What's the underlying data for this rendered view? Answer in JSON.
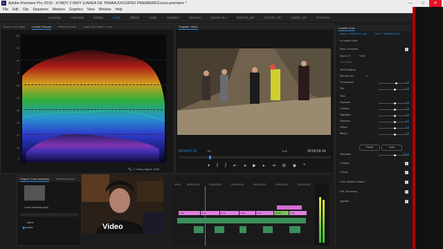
{
  "window": {
    "title": "Adobe Premiere Pro 2019 - X:\\NDY 2 INDY (LAREA DE TRABAJO\\CURSO PREMIERE\\Curso premiere *",
    "controls": [
      "—",
      "□",
      "✕"
    ]
  },
  "menu": [
    "File",
    "Edit",
    "Clip",
    "Sequence",
    "Markers",
    "Graphics",
    "View",
    "Window",
    "Help"
  ],
  "workspaces": [
    "Learning",
    "Assembly",
    "Editing",
    "Color",
    "Effects",
    "Audio",
    "Graphics",
    "Libraries",
    "Edición Pr.x",
    "EDITOR_SP",
    "COLOR_SP",
    "AUDIO_SP",
    "All Panels"
  ],
  "active_workspace": "Color",
  "scopes_panel": {
    "tabs": [
      "Source: (no clips)",
      "Lumetri Scopes",
      "Effect Controls",
      "Audio Clip Mixer: Curso"
    ],
    "active_tab": "Lumetri Scopes",
    "y_labels": [
      "100",
      "90",
      "80",
      "70",
      "60",
      "50",
      "40",
      "30",
      "20",
      "10",
      "0"
    ],
    "footer_clamp": "Clamp Signal",
    "footer_bit": "8 Bit"
  },
  "program_monitor": {
    "tab": "Program: Video",
    "timecode_current": "00:00:07:22",
    "fit": "Fit",
    "quality": "Full",
    "timecode_duration": "00:00:09:14"
  },
  "project_panel": {
    "tabs": [
      "Project: Curso premiere",
      "Media Browser"
    ],
    "file_name": "Curso premiere.prproj",
    "column_name": "Name",
    "item": "Audios"
  },
  "webcam": {
    "overlay_text": "Video"
  },
  "timeline": {
    "ruler": [
      "00:00",
      "00:00:04:23",
      "00:00:09:23",
      "00:00:14:23",
      "00:00:19:23",
      "00:00:24:23",
      "00:00:29:23"
    ],
    "clips_v1": [
      "Cubo",
      "Cubo",
      "Cubo",
      "Cubo",
      "Cubo",
      "Lumetri",
      "Cubo"
    ]
  },
  "lumetri_color": {
    "tab": "Lumetri Color",
    "master": "Master * 98B80020.mp4",
    "clip": "Video * 98B80020.mp4",
    "effect": "fx Lumetri Color",
    "basic_correction": "Basic Correction",
    "input_lut_label": "Input LUT",
    "input_lut_value": "None",
    "hdr_white": "HDR White",
    "white_balance": "White Balance",
    "wb_selector": "WB Selector",
    "sliders": [
      {
        "label": "Temperature",
        "value": "0.0",
        "pos": 0.55
      },
      {
        "label": "Tint",
        "value": "0.0",
        "pos": 0.5
      }
    ],
    "tone": "Tone",
    "tone_sliders": [
      {
        "label": "Exposure",
        "value": "0.0",
        "pos": 0.5
      },
      {
        "label": "Contrast",
        "value": "0.0",
        "pos": 0.5
      },
      {
        "label": "Highlights",
        "value": "0.0",
        "pos": 0.5
      },
      {
        "label": "Shadows",
        "value": "0.0",
        "pos": 0.5
      },
      {
        "label": "Whites",
        "value": "0.0",
        "pos": 0.5
      },
      {
        "label": "Blacks",
        "value": "0.0",
        "pos": 0.5
      }
    ],
    "reset": "Reset",
    "auto": "Auto",
    "saturation": {
      "label": "Saturation",
      "value": "100.0",
      "pos": 0.5
    },
    "sections": [
      "Creative",
      "Curves",
      "Color Wheels & Match",
      "HSL Secondary",
      "Vignette"
    ]
  }
}
